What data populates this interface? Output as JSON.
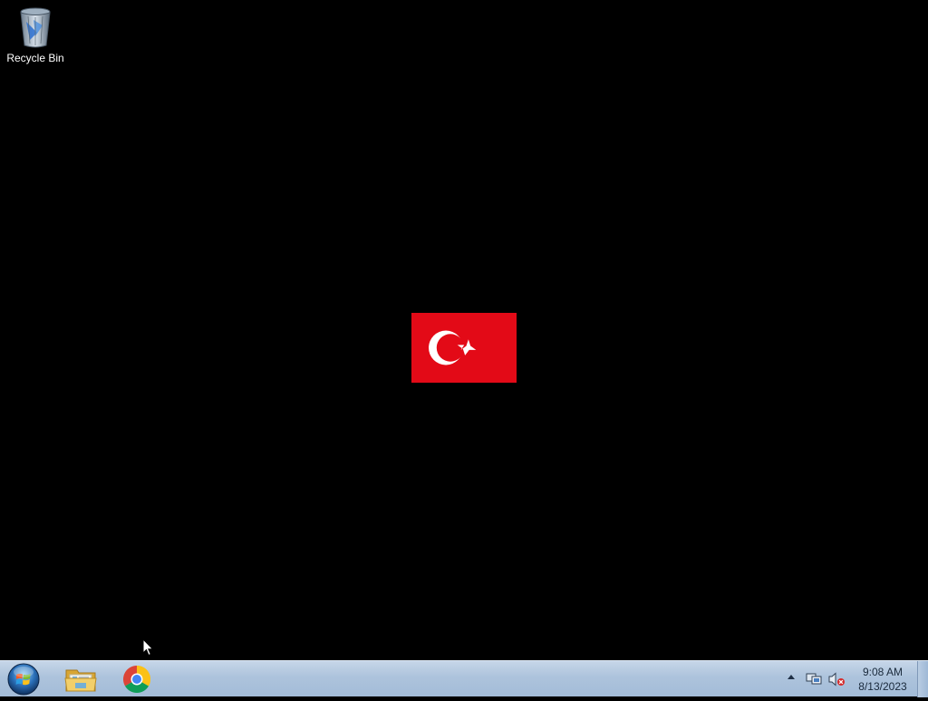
{
  "desktop": {
    "background_color": "#000000",
    "icons": [
      {
        "label": "Recycle Bin",
        "icon": "recycle-bin-icon"
      }
    ],
    "wallpaper": {
      "subject": "turkish-flag",
      "flag_red": "#E30A17",
      "emblem_color": "#FFFFFF"
    }
  },
  "taskbar": {
    "start_button": {
      "icon": "windows-logo-icon"
    },
    "pinned": [
      {
        "name": "Windows Explorer",
        "icon": "folder-explorer-icon"
      },
      {
        "name": "Google Chrome",
        "icon": "chrome-icon"
      }
    ],
    "tray": {
      "icons": [
        "show-hidden-icons-arrow",
        "network-icon",
        "volume-muted-icon"
      ],
      "time": "9:08 AM",
      "date": "8/13/2023"
    }
  }
}
